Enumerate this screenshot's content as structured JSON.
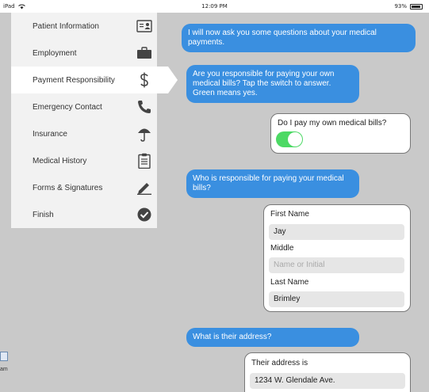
{
  "status_bar": {
    "device": "iPad",
    "time": "12:09 PM",
    "battery": "93%"
  },
  "sidebar": {
    "items": [
      {
        "label": "Patient Information",
        "icon": "id-card-icon"
      },
      {
        "label": "Employment",
        "icon": "briefcase-icon"
      },
      {
        "label": "Payment Responsibility",
        "icon": "dollar-icon",
        "active": true
      },
      {
        "label": "Emergency Contact",
        "icon": "phone-icon"
      },
      {
        "label": "Insurance",
        "icon": "umbrella-icon"
      },
      {
        "label": "Medical History",
        "icon": "clipboard-icon"
      },
      {
        "label": "Forms & Signatures",
        "icon": "pen-icon"
      },
      {
        "label": "Finish",
        "icon": "check-circle-icon"
      }
    ]
  },
  "chat": {
    "q1": "I will now ask you some questions about your medical payments.",
    "q2": "Are you responsible for paying your own medical bills? Tap the switch to answer. Green means yes.",
    "a1": {
      "label": "Do I pay my own medical bills?",
      "toggle_on": true
    },
    "q3": "Who is responsible for paying your medical bills?",
    "form": {
      "first_name_label": "First Name",
      "first_name_value": "Jay",
      "middle_label": "Middle",
      "middle_placeholder": "Name or Initial",
      "last_name_label": "Last Name",
      "last_name_value": "Brimley"
    },
    "q4": "What is their address?",
    "address": {
      "label": "Their address is",
      "value": "1234 W. Glendale Ave."
    }
  },
  "bottom_left": {
    "text": "am"
  },
  "colors": {
    "accent": "#3a8fe0",
    "toggle_on": "#4cd964",
    "background": "#c9c9c9"
  }
}
